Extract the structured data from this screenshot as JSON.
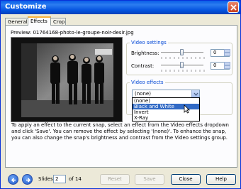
{
  "window": {
    "title": "Customize",
    "close_label": "×"
  },
  "tabs": [
    {
      "label": "General",
      "active": false
    },
    {
      "label": "Effects",
      "active": true
    },
    {
      "label": "Crop",
      "active": false
    }
  ],
  "preview": {
    "label": "Preview:",
    "filename": "01764168-photo-le-groupe-noir-desir.jpg"
  },
  "video_settings": {
    "legend": "Video settings",
    "brightness_label": "Brightness:",
    "brightness_value": "0",
    "brightness_level": 0.5,
    "contrast_label": "Contrast:",
    "contrast_value": "0",
    "contrast_level": 0.5
  },
  "video_effects": {
    "legend": "Video effects",
    "selected": "(none)",
    "options": [
      "(none)",
      "Black and White",
      "Invert",
      "X-Ray"
    ],
    "highlighted": "Black and White"
  },
  "help_text": "To apply an effect to the current snap, select an effect from the Video effects dropdown and click 'Save'. You can remove the effect by selecting '(none)'. To enhance the snap, you can also change the snap's brightness and contrast from the Video settings group.",
  "navigation": {
    "slides_label": "Slides",
    "slide_current": "2",
    "slide_total_text": "of 14"
  },
  "buttons": {
    "reset": "Reset",
    "save": "Save",
    "close": "Close",
    "help": "Help"
  },
  "colors": {
    "title_bar": "#0a5ee8",
    "group_legend": "#0046d5",
    "selection": "#316ac5"
  }
}
